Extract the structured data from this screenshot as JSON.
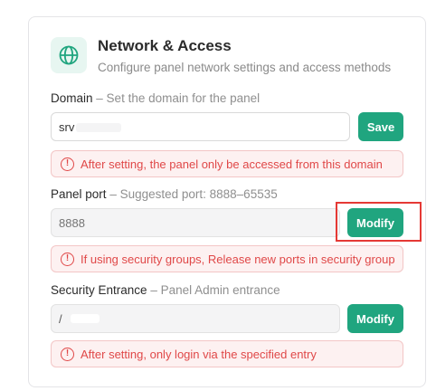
{
  "header": {
    "icon": "globe-icon",
    "title": "Network & Access",
    "subtitle": "Configure panel network settings and access methods"
  },
  "domain": {
    "label": "Domain",
    "hint": "– Set the domain for the panel",
    "value": "srv",
    "save_label": "Save",
    "alert": "After setting, the panel only be accessed from this domain"
  },
  "panel_port": {
    "label": "Panel port",
    "hint": "– Suggested port: 8888–65535",
    "placeholder": "8888",
    "modify_label": "Modify",
    "alert": "If using security groups, Release new ports in security group"
  },
  "security_entrance": {
    "label": "Security Entrance",
    "hint": "– Panel Admin entrance",
    "value": "/",
    "modify_label": "Modify",
    "alert": "After setting, only login via the specified entry"
  },
  "colors": {
    "accent": "#20a57f",
    "alert_text": "#e04848",
    "alert_bg": "#fdf1f1",
    "highlight": "#e53935"
  }
}
